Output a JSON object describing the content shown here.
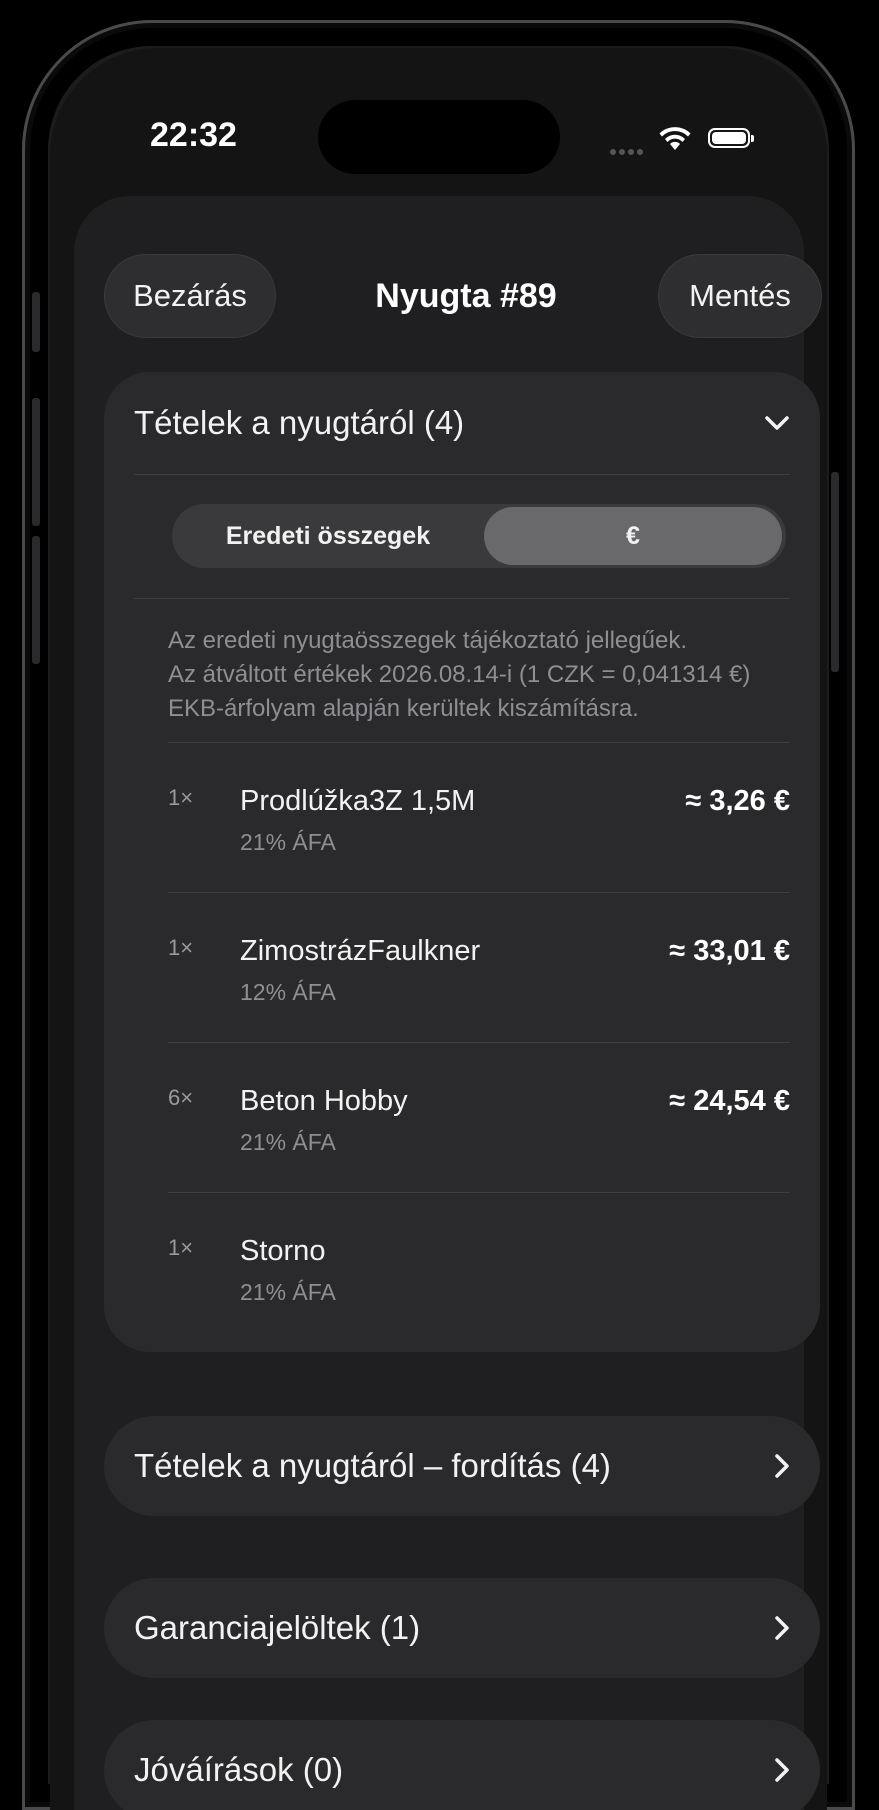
{
  "status_bar": {
    "time": "22:32"
  },
  "header": {
    "close_label": "Bezárás",
    "title": "Nyugta #89",
    "save_label": "Mentés"
  },
  "items_section": {
    "title": "Tételek a nyugtáról (4)",
    "segment": {
      "options": [
        "Eredeti összegek",
        "€"
      ],
      "selected": "€"
    },
    "info_lines": [
      "Az eredeti nyugtaösszegek tájékoztató jellegűek.",
      "Az átváltott értékek 2026.08.14-i (1 CZK = 0,041314 €)",
      "EKB-árfolyam alapján kerültek kiszámításra."
    ],
    "items": [
      {
        "qty": "1×",
        "name": "Prodlúžka3Z 1,5M",
        "vat": "21% ÁFA",
        "price": "≈ 3,26 €"
      },
      {
        "qty": "1×",
        "name": "ZimostrázFaulkner",
        "vat": "12% ÁFA",
        "price": "≈ 33,01 €"
      },
      {
        "qty": "6×",
        "name": "Beton Hobby",
        "vat": "21% ÁFA",
        "price": "≈ 24,54 €"
      },
      {
        "qty": "1×",
        "name": "Storno",
        "vat": "21% ÁFA",
        "price": ""
      }
    ]
  },
  "nav_rows": [
    {
      "label": "Tételek a nyugtáról – fordítás (4)"
    },
    {
      "label": "Garanciajelöltek (1)"
    },
    {
      "label": "Jóváírások (0)"
    }
  ]
}
